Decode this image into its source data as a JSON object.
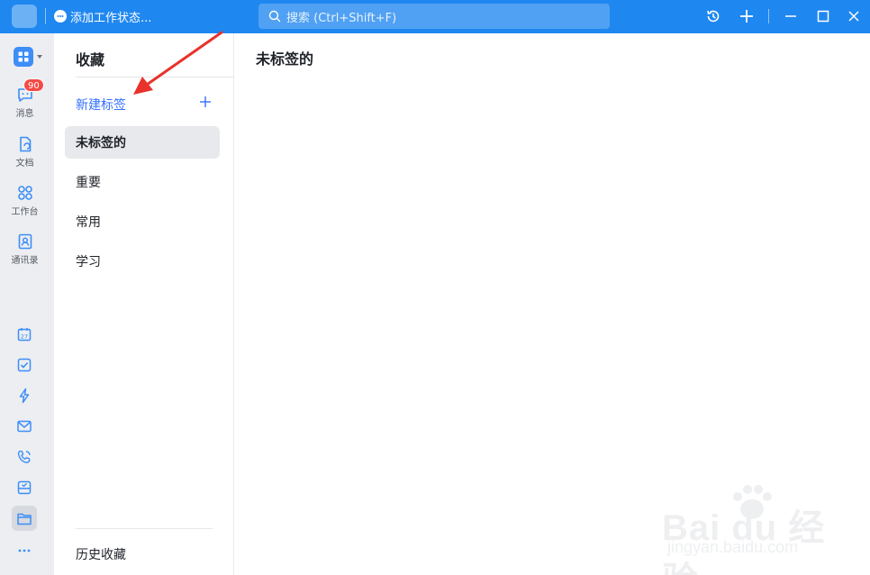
{
  "titlebar": {
    "status_label": "添加工作状态...",
    "search_placeholder": "搜索 (Ctrl+Shift+F)"
  },
  "rail": {
    "messages_label": "消息",
    "messages_badge": "90",
    "docs_label": "文档",
    "workbench_label": "工作台",
    "contacts_label": "通讯录",
    "calendar_day": "27"
  },
  "panel": {
    "title": "收藏",
    "new_tag_label": "新建标签",
    "tags": [
      {
        "label": "未标签的"
      },
      {
        "label": "重要"
      },
      {
        "label": "常用"
      },
      {
        "label": "学习"
      }
    ],
    "history_label": "历史收藏"
  },
  "main": {
    "title": "未标签的"
  },
  "watermark": {
    "brand": "Bai  du 经验",
    "url": "jingyan.baidu.com"
  },
  "colors": {
    "titlebar": "#1f87f0",
    "accent": "#3370ff",
    "badge": "#f54a45",
    "arrow": "#e8322b"
  }
}
